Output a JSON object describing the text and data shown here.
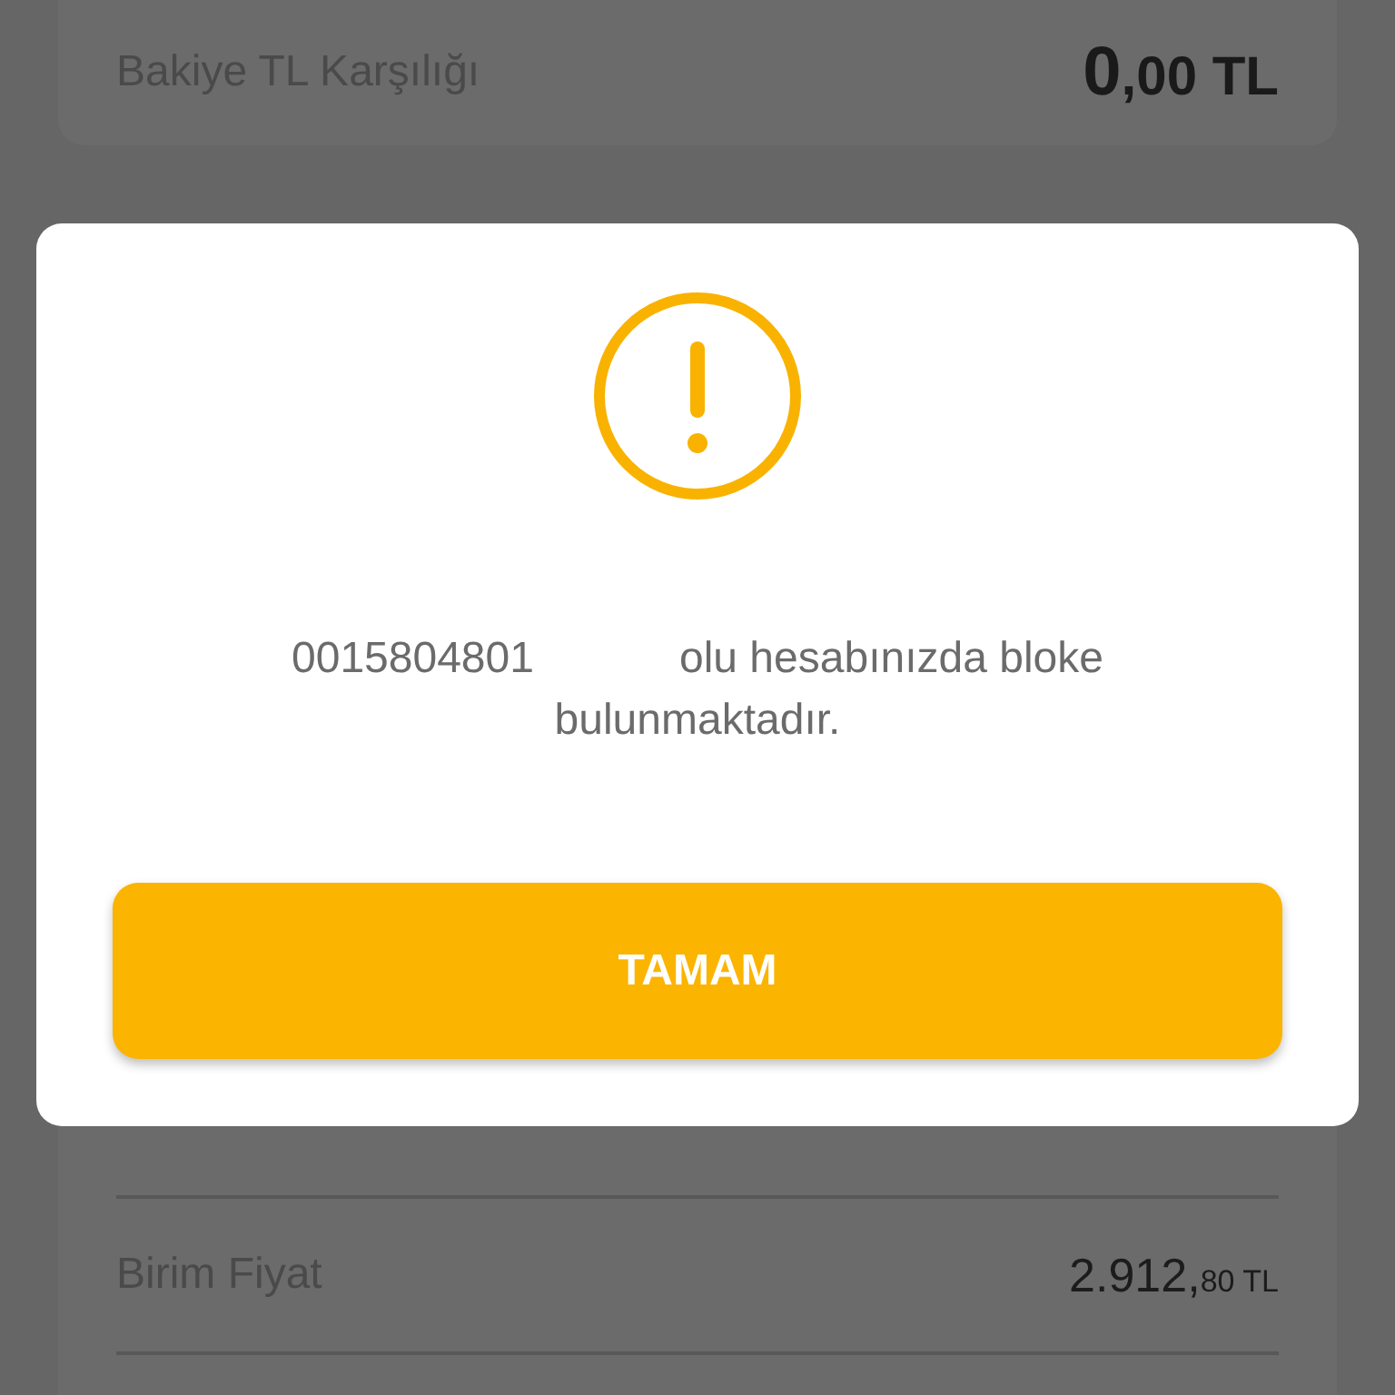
{
  "balance": {
    "label": "Bakiye TL Karşılığı",
    "value_main": "0",
    "value_rest": ",00 TL"
  },
  "price_row": {
    "label": "Birim Fiyat",
    "value_main": "2.912,",
    "value_rest": "80 TL"
  },
  "dialog": {
    "message_start": "0015804801",
    "message_end": "olu hesabınızda bloke bulunmaktadır.",
    "button": "TAMAM"
  }
}
